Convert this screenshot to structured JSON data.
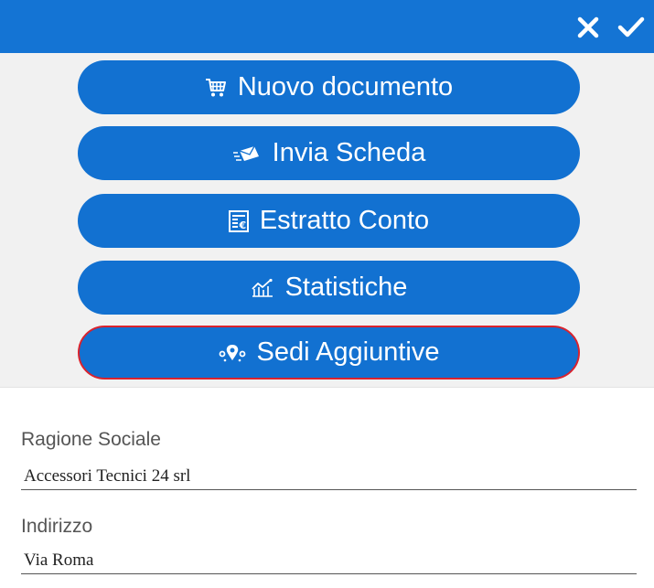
{
  "header": {
    "cancel_icon": "close-icon",
    "confirm_icon": "check-icon",
    "background_color": "#1474d4"
  },
  "actions": [
    {
      "label": "Nuovo documento",
      "icon": "cart-icon"
    },
    {
      "label": "Invia Scheda",
      "icon": "send-mail-icon"
    },
    {
      "label": "Estratto Conto",
      "icon": "euro-statement-icon"
    },
    {
      "label": "Statistiche",
      "icon": "chart-icon"
    },
    {
      "label": "Sedi Aggiuntive",
      "icon": "location-pins-icon",
      "selected": true
    }
  ],
  "form": {
    "ragione_sociale": {
      "label": "Ragione Sociale",
      "value": "Accessori Tecnici 24 srl"
    },
    "indirizzo": {
      "label": "Indirizzo",
      "value": "Via Roma"
    }
  },
  "colors": {
    "accent": "#1271d1",
    "selected_border": "#d9232e"
  }
}
